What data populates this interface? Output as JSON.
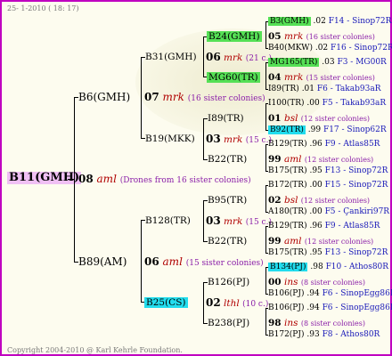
{
  "header": {
    "date": "25-  1-2010 ( 18: 17)"
  },
  "footer": {
    "copyright": "Copyright 2004-2010 @ Karl Kehrle Foundation."
  },
  "root": {
    "label": "B11(GMH)"
  },
  "gen1": {
    "code": "08",
    "breed": "aml",
    "note": "(Drones from 16 sister colonies)"
  },
  "parents": {
    "upper": {
      "label": "B6(GMH)",
      "code": "07",
      "breed": "mrk",
      "note": "(16 sister colonies)"
    },
    "lower": {
      "label": "B89(AM)",
      "code": "06",
      "breed": "aml",
      "note": "(15 sister colonies)"
    }
  },
  "grandparents": {
    "g1": {
      "label": "B31(GMH)",
      "code": "06",
      "breed": "mrk",
      "note": "(21 c.)"
    },
    "g2": {
      "label": "B19(MKK)",
      "code": "03",
      "breed": "mrk",
      "note": "(15 c.)"
    },
    "g3": {
      "label": "B128(TR)",
      "code": "03",
      "breed": "mrk",
      "note": "(15 c.)"
    },
    "g4": {
      "label": "B25(CS)",
      "code": "02",
      "breed": "lthl",
      "note": "(10 c.)"
    }
  },
  "greatgrand": {
    "a": {
      "label": "B24(GMH)",
      "code": "05",
      "breed": "mrk",
      "note": "(16 sister colonies)"
    },
    "b": {
      "label": "MG60(TR)",
      "code": "04",
      "breed": "mrk",
      "note": "(15 sister colonies)"
    },
    "c": {
      "label": "I89(TR)",
      "code": "01",
      "breed": "bsl",
      "note": "(12 sister colonies)"
    },
    "d": {
      "label": "B22(TR)",
      "code": "99",
      "breed": "aml",
      "note": "(12 sister colonies)"
    },
    "e": {
      "label": "B95(TR)",
      "code": "02",
      "breed": "bsl",
      "note": "(12 sister colonies)"
    },
    "f": {
      "label": "B22(TR)",
      "code": "99",
      "breed": "aml",
      "note": "(12 sister colonies)"
    },
    "g": {
      "label": "B126(PJ)",
      "code": "00",
      "breed": "ins",
      "note": "(8 sister colonies)"
    },
    "h": {
      "label": "B238(PJ)",
      "code": "98",
      "breed": "ins",
      "note": "(8 sister colonies)"
    }
  },
  "ancestors": [
    {
      "label": "B3(GMH)",
      "year": ".02",
      "origin": "F14 - Sinop72R"
    },
    {
      "label": "B40(MKW)",
      "year": ".02",
      "origin": "F16 - Sinop72R"
    },
    {
      "label": "MG165(TR)",
      "year": ".03",
      "origin": "F3 - MG00R"
    },
    {
      "label": "I89(TR)",
      "year": ".01",
      "origin": "F6 - Takab93aR"
    },
    {
      "label": "I100(TR)",
      "year": ".00",
      "origin": "F5 - Takab93aR"
    },
    {
      "label": "B92(TR)",
      "year": ".99",
      "origin": "F17 - Sinop62R"
    },
    {
      "label": "B129(TR)",
      "year": ".96",
      "origin": "F9 - Atlas85R"
    },
    {
      "label": "B175(TR)",
      "year": ".95",
      "origin": "F13 - Sinop72R"
    },
    {
      "label": "B172(TR)",
      "year": ".00",
      "origin": "F15 - Sinop72R"
    },
    {
      "label": "A180(TR)",
      "year": ".00",
      "origin": "F5 - Çankiri97R"
    },
    {
      "label": "B129(TR)",
      "year": ".96",
      "origin": "F9 - Atlas85R"
    },
    {
      "label": "B175(TR)",
      "year": ".95",
      "origin": "F13 - Sinop72R"
    },
    {
      "label": "B134(PJ)",
      "year": ".98",
      "origin": "F10 - Athos80R"
    },
    {
      "label": "B106(PJ)",
      "year": ".94",
      "origin": "F6 - SinopEgg86R"
    },
    {
      "label": "B106(PJ)",
      "year": ".94",
      "origin": "F6 - SinopEgg86R"
    },
    {
      "label": "B172(PJ)",
      "year": ".93",
      "origin": "F8 - Athos80R"
    }
  ]
}
